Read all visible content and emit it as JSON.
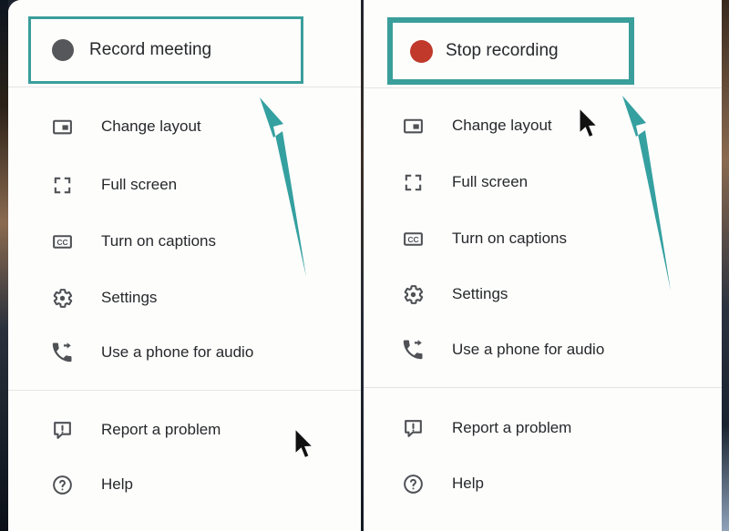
{
  "comparison": {
    "caption_left": "Record meeting",
    "caption_right": "Stop recording"
  },
  "colors": {
    "highlight_teal": "#3a9e9b",
    "arrow_teal": "#35a0a0",
    "record_dot_idle": "#55575a",
    "record_dot_active": "#c0392b",
    "icon_grey": "#4f5155",
    "text_dark": "#26282b",
    "panel_bg": "#fdfdfc",
    "divider": "#e4e4e6"
  },
  "panels": [
    {
      "id": "before",
      "record_row": {
        "label": "Record meeting",
        "icon": "record-dot-idle-icon",
        "dot_color": "#55575a",
        "highlighted": true,
        "highlight_border_px": 3
      },
      "groups": [
        {
          "items": [
            {
              "label": "Change layout",
              "icon": "change-layout-icon"
            },
            {
              "label": "Full screen",
              "icon": "full-screen-icon"
            },
            {
              "label": "Turn on captions",
              "icon": "closed-captions-icon"
            },
            {
              "label": "Settings",
              "icon": "gear-icon"
            },
            {
              "label": "Use a phone for audio",
              "icon": "phone-forward-icon"
            }
          ]
        },
        {
          "items": [
            {
              "label": "Report a problem",
              "icon": "report-problem-icon"
            },
            {
              "label": "Help",
              "icon": "help-circle-icon"
            }
          ]
        }
      ],
      "annotations": {
        "arrow": "teal-arrow-pointing-up-left",
        "cursor": "mouse-pointer"
      }
    },
    {
      "id": "after",
      "record_row": {
        "label": "Stop recording",
        "icon": "record-dot-active-icon",
        "dot_color": "#c0392b",
        "highlighted": true,
        "highlight_border_px": 6
      },
      "groups": [
        {
          "items": [
            {
              "label": "Change layout",
              "icon": "change-layout-icon"
            },
            {
              "label": "Full screen",
              "icon": "full-screen-icon"
            },
            {
              "label": "Turn on captions",
              "icon": "closed-captions-icon"
            },
            {
              "label": "Settings",
              "icon": "gear-icon"
            },
            {
              "label": "Use a phone for audio",
              "icon": "phone-forward-icon"
            }
          ]
        },
        {
          "items": [
            {
              "label": "Report a problem",
              "icon": "report-problem-icon"
            },
            {
              "label": "Help",
              "icon": "help-circle-icon"
            }
          ]
        }
      ],
      "annotations": {
        "arrow": "teal-arrow-pointing-up-left",
        "cursor": "mouse-pointer"
      }
    }
  ]
}
